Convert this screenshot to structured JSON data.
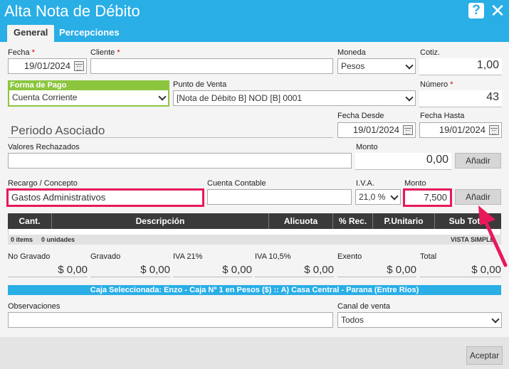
{
  "window": {
    "title": "Alta Nota de Débito",
    "help_label": "?",
    "close_label": "✕"
  },
  "tabs": [
    {
      "label": "General"
    },
    {
      "label": "Percepciones"
    }
  ],
  "fields": {
    "fecha": {
      "label": "Fecha",
      "value": "19/01/2024"
    },
    "cliente": {
      "label": "Cliente",
      "value": ""
    },
    "moneda": {
      "label": "Moneda",
      "value": "Pesos"
    },
    "cotiz": {
      "label": "Cotiz.",
      "value": "1,00"
    },
    "forma_pago": {
      "label": "Forma de Pago",
      "value": "Cuenta Corriente"
    },
    "punto_venta": {
      "label": "Punto de Venta",
      "value": "[Nota de Débito B] NOD [B] 0001"
    },
    "numero": {
      "label": "Número",
      "value": "43"
    },
    "periodo_asociado": {
      "label": "Periodo Asociado"
    },
    "fecha_desde": {
      "label": "Fecha Desde",
      "value": "19/01/2024"
    },
    "fecha_hasta": {
      "label": "Fecha Hasta",
      "value": "19/01/2024"
    },
    "valores_rechazados": {
      "label": "Valores Rechazados",
      "value": ""
    },
    "monto_rechazados": {
      "label": "Monto",
      "value": "0,00"
    },
    "recargo_concepto": {
      "label": "Recargo / Concepto",
      "value": "Gastos Administrativos"
    },
    "cuenta_contable": {
      "label": "Cuenta Contable",
      "value": ""
    },
    "iva": {
      "label": "I.V.A.",
      "value": "21,0 %"
    },
    "monto_recargo": {
      "label": "Monto",
      "value": "7,500"
    },
    "observaciones": {
      "label": "Observaciones",
      "value": ""
    },
    "canal_venta": {
      "label": "Canal de venta",
      "value": "Todos"
    }
  },
  "required_mark": "*",
  "buttons": {
    "anadir1": "Añadir",
    "anadir2": "Añadir",
    "aceptar": "Aceptar"
  },
  "grid": {
    "columns": [
      "Cant.",
      "Descripción",
      "Alicuota",
      "% Rec.",
      "P.Unitario",
      "Sub Total"
    ],
    "footer_items": "0 ítems",
    "footer_units": "0 unidades",
    "footer_view": "VISTA SIMPLE"
  },
  "totals": [
    {
      "label": "No Gravado",
      "value": "$ 0,00"
    },
    {
      "label": "Gravado",
      "value": "$ 0,00"
    },
    {
      "label": "IVA 21%",
      "value": "$ 0,00"
    },
    {
      "label": "IVA 10,5%",
      "value": "$ 0,00"
    },
    {
      "label": "Exento",
      "value": "$ 0,00"
    },
    {
      "label": "Total",
      "value": "$ 0,00"
    }
  ],
  "caja": "Caja Seleccionada: Enzo - Caja Nº 1 en Pesos ($) :: A) Casa Central - Parana (Entre Ríos)",
  "colors": {
    "accent": "#29aee6",
    "highlight": "#e8195a",
    "forma_pago_header": "#8cc63f"
  },
  "icons": [
    "help-icon",
    "close-icon",
    "calendar-icon",
    "chevron-down-icon",
    "arrow-annotation"
  ]
}
